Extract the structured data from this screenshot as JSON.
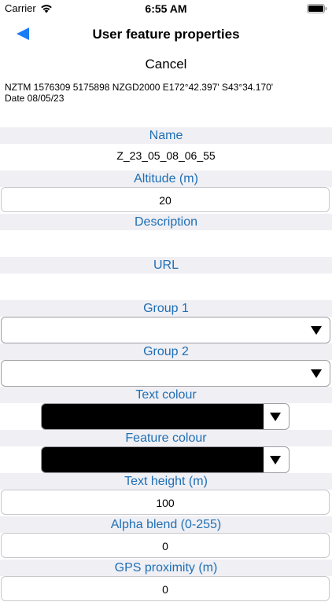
{
  "status": {
    "carrier": "Carrier",
    "time": "6:55 AM"
  },
  "nav": {
    "title": "User feature properties",
    "back_icon": "left-triangle"
  },
  "cancel_label": "Cancel",
  "coords": {
    "line1": "NZTM 1576309 5175898  NZGD2000 E172°42.397' S43°34.170'",
    "line2": "Date 08/05/23"
  },
  "fields": {
    "name": {
      "label": "Name",
      "value": "Z_23_05_08_06_55"
    },
    "altitude": {
      "label": "Altitude (m)",
      "value": "20"
    },
    "description": {
      "label": "Description",
      "value": ""
    },
    "url": {
      "label": "URL",
      "value": ""
    },
    "group1": {
      "label": "Group 1",
      "value": ""
    },
    "group2": {
      "label": "Group 2",
      "value": ""
    },
    "text_colour": {
      "label": "Text colour",
      "color": "#000000"
    },
    "feature_colour": {
      "label": "Feature colour",
      "color": "#000000"
    },
    "text_height": {
      "label": "Text height (m)",
      "value": "100"
    },
    "alpha_blend": {
      "label": "Alpha blend (0-255)",
      "value": "0"
    },
    "gps_proximity": {
      "label": "GPS proximity (m)",
      "value": "0"
    }
  },
  "colors": {
    "accent_label": "#1f6fb5",
    "back_arrow": "#1a7cf5",
    "label_bg": "#efeff4"
  }
}
